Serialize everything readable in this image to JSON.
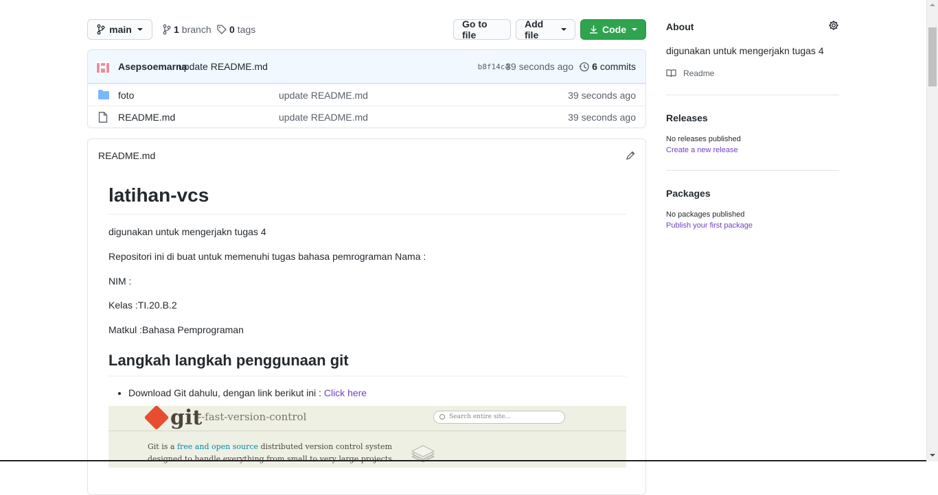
{
  "toolbar": {
    "branch_button": "main",
    "branch_count": "1",
    "branch_label": "branch",
    "tag_count": "0",
    "tag_label": "tags",
    "go_to_file": "Go to file",
    "add_file": "Add file",
    "code": "Code"
  },
  "latest_commit": {
    "author": "Asepsoemarna",
    "message": "update README.md",
    "sha": "b8f14c4",
    "time": "39 seconds ago",
    "commit_count": "6",
    "commit_label": "commits"
  },
  "files": [
    {
      "name": "foto",
      "type": "folder",
      "message": "update README.md",
      "time": "39 seconds ago"
    },
    {
      "name": "README.md",
      "type": "file",
      "message": "update README.md",
      "time": "39 seconds ago"
    }
  ],
  "readme": {
    "filename": "README.md",
    "h1": "latihan-vcs",
    "p1": "digunakan untuk mengerjakn tugas 4",
    "p2": "Repositori ini di buat untuk memenuhi tugas bahasa pemrograman Nama :",
    "p3": "NIM :",
    "p4": "Kelas :TI.20.B.2",
    "p5": "Matkul :Bahasa Pemprograman",
    "h2": "Langkah langkah penggunaan git",
    "li1_text": "Download Git dahulu, dengan link berikut ini :",
    "li1_link": "Click here",
    "git_image": {
      "logo": "git",
      "tagline": "--fast-version-control",
      "search_placeholder": "Search entire site...",
      "blurb_pre": "Git is a",
      "blurb_link": "free and open source",
      "blurb_post": "distributed version control system designed to handle everything from small to very large projects with"
    }
  },
  "sidebar": {
    "about_title": "About",
    "about_desc": "digunakan untuk mengerjakn tugas 4",
    "readme_link": "Readme",
    "releases_title": "Releases",
    "releases_none": "No releases published",
    "releases_link": "Create a new release",
    "packages_title": "Packages",
    "packages_none": "No packages published",
    "packages_link": "Publish your first package"
  },
  "colors": {
    "accent_green": "#2ea44f",
    "link_purple": "#6f42c1",
    "folder_blue": "#79b8ff",
    "commit_bg": "#f1f8ff"
  }
}
